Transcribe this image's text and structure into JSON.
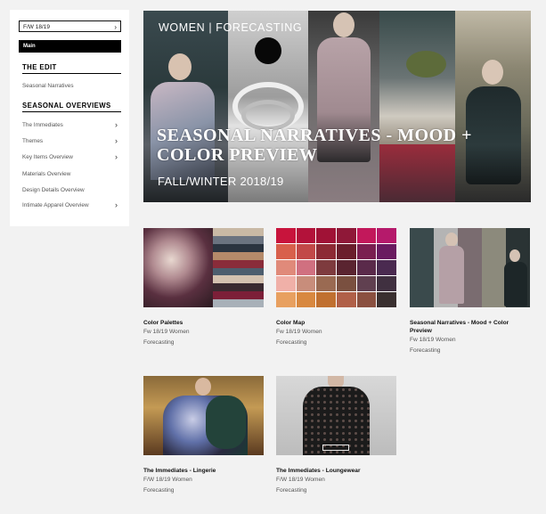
{
  "sidebar": {
    "season_select": "F/W 18/19",
    "main_button": "Main",
    "the_edit_heading": "THE EDIT",
    "the_edit_items": [
      {
        "label": "Seasonal Narratives"
      }
    ],
    "overviews_heading": "SEASONAL OVERVIEWS",
    "overview_items": [
      {
        "label": "The Immediates",
        "has_arrow": true
      },
      {
        "label": "Themes",
        "has_arrow": true
      },
      {
        "label": "Key Items Overview",
        "has_arrow": true
      },
      {
        "label": "Materials Overview",
        "has_arrow": false
      },
      {
        "label": "Design Details Overview",
        "has_arrow": false
      },
      {
        "label": "Intimate Apparel Overview",
        "has_arrow": true
      }
    ]
  },
  "hero": {
    "tag": "WOMEN | FORECASTING",
    "title": "SEASONAL NARRATIVES - MOOD + COLOR PREVIEW",
    "subtitle": "FALL/WINTER 2018/19"
  },
  "cards": [
    {
      "title": "Color Palettes",
      "meta1": "Fw 18/19 Women",
      "meta2": "Forecasting"
    },
    {
      "title": "Color Map",
      "meta1": "Fw 18/19 Women",
      "meta2": "Forecasting"
    },
    {
      "title": "Seasonal Narratives - Mood + Color Preview",
      "meta1": "Fw 18/19 Women",
      "meta2": "Forecasting"
    },
    {
      "title": "The Immediates - Lingerie",
      "meta1": "F/W 18/19 Women",
      "meta2": "Forecasting"
    },
    {
      "title": "The Immediates - Loungewear",
      "meta1": "F/W 18/19 Women",
      "meta2": "Forecasting"
    }
  ],
  "colors": {
    "page_bg": "#f2f2f2",
    "accent": "#000000",
    "palette_stripes": [
      "#c9b9a5",
      "#6b7380",
      "#2b3440",
      "#b58a6a",
      "#8a2c3a",
      "#4d5e6e",
      "#d4c2b0",
      "#3a2a30",
      "#7c1f38",
      "#a8b0b8"
    ],
    "color_map": [
      "#c8143c",
      "#b3123a",
      "#a01236",
      "#8f1838",
      "#c2185b",
      "#b51a6b",
      "#d8604c",
      "#c24848",
      "#8d2a34",
      "#6b1e2c",
      "#7a1f50",
      "#6a1b60",
      "#e08a7a",
      "#d07080",
      "#7e3b3e",
      "#5a2430",
      "#5a2a4a",
      "#4a2a50",
      "#f0b0a8",
      "#c88d7b",
      "#9a6a52",
      "#7a5040",
      "#604050",
      "#403040",
      "#e8a060",
      "#d88840",
      "#c07030",
      "#b06048",
      "#8a5040",
      "#3a3030"
    ]
  },
  "icons": {
    "dropdown": "chevron-right-icon",
    "submenu": "chevron-right-icon"
  }
}
